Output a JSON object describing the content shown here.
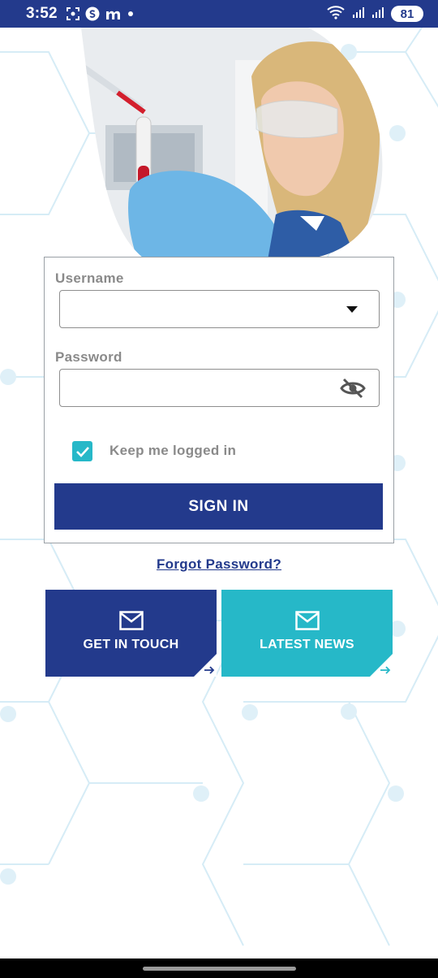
{
  "status_bar": {
    "time": "3:52",
    "battery": "81",
    "icons_left": [
      "screenshot-icon",
      "s-app-icon",
      "m-app-icon",
      "dot-icon"
    ],
    "icons_right": [
      "wifi-icon",
      "signal-icon",
      "signal-icon",
      "battery-icon"
    ]
  },
  "form": {
    "username_label": "Username",
    "username_value": "",
    "password_label": "Password",
    "password_value": "",
    "keep_logged_in_label": "Keep me logged in",
    "keep_logged_in_checked": true,
    "signin_label": "SIGN IN"
  },
  "forgot_password": "Forgot Password?",
  "tiles": [
    {
      "label": "GET IN TOUCH",
      "icon": "mail-icon"
    },
    {
      "label": "LATEST NEWS",
      "icon": "mail-icon"
    }
  ],
  "colors": {
    "primary": "#233a8c",
    "accent": "#26b8c8",
    "field_border": "#8e8e8e",
    "label_text": "#8a8a8a"
  }
}
